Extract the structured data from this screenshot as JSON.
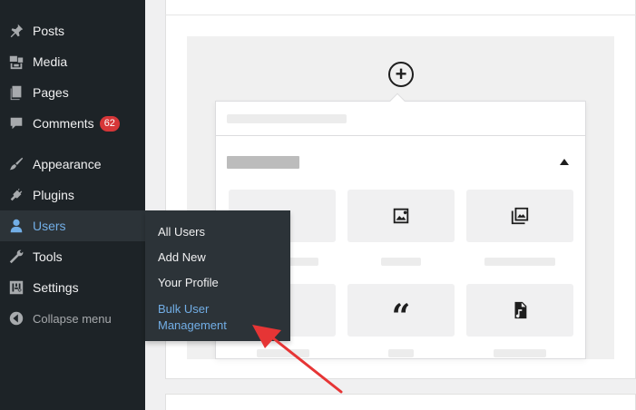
{
  "sidebar": {
    "items": [
      {
        "id": "posts",
        "label": "Posts",
        "icon": "pin-icon"
      },
      {
        "id": "media",
        "label": "Media",
        "icon": "media-icon"
      },
      {
        "id": "pages",
        "label": "Pages",
        "icon": "pages-icon"
      },
      {
        "id": "comments",
        "label": "Comments",
        "icon": "comment-icon",
        "badge": "62"
      },
      {
        "id": "appearance",
        "label": "Appearance",
        "icon": "paintbrush-icon"
      },
      {
        "id": "plugins",
        "label": "Plugins",
        "icon": "plug-icon"
      },
      {
        "id": "users",
        "label": "Users",
        "icon": "user-icon",
        "current": true
      },
      {
        "id": "tools",
        "label": "Tools",
        "icon": "wrench-icon"
      },
      {
        "id": "settings",
        "label": "Settings",
        "icon": "sliders-icon"
      }
    ],
    "collapse_label": "Collapse menu"
  },
  "flyout": {
    "items": [
      {
        "label": "All Users"
      },
      {
        "label": "Add New"
      },
      {
        "label": "Your Profile"
      },
      {
        "label": "Bulk User Management",
        "highlighted": true
      }
    ]
  },
  "editor": {
    "inserter_symbol": "+",
    "quote_glyph": "“"
  },
  "colors": {
    "sidebar_bg": "#1d2327",
    "submenu_bg": "#2c3338",
    "accent": "#72aee6",
    "badge": "#d63638",
    "annotation": "#e63535"
  }
}
